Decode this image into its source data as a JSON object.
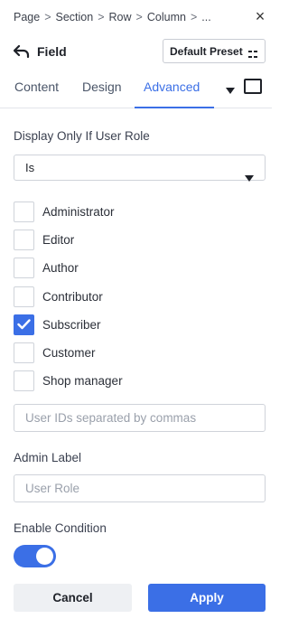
{
  "breadcrumb": {
    "items": [
      "Page",
      "Section",
      "Row",
      "Column",
      "..."
    ],
    "separator": ">"
  },
  "close_glyph": "×",
  "header": {
    "title": "Field",
    "preset_label": "Default Preset"
  },
  "tabs": [
    {
      "label": "Content",
      "active": false
    },
    {
      "label": "Design",
      "active": false
    },
    {
      "label": "Advanced",
      "active": true
    }
  ],
  "display_condition": {
    "label": "Display Only If User Role",
    "operator_value": "Is",
    "roles": [
      {
        "label": "Administrator",
        "checked": false
      },
      {
        "label": "Editor",
        "checked": false
      },
      {
        "label": "Author",
        "checked": false
      },
      {
        "label": "Contributor",
        "checked": false
      },
      {
        "label": "Subscriber",
        "checked": true
      },
      {
        "label": "Customer",
        "checked": false
      },
      {
        "label": "Shop manager",
        "checked": false
      }
    ],
    "user_ids_placeholder": "User IDs separated by commas"
  },
  "admin_label": {
    "label": "Admin Label",
    "placeholder": "User Role"
  },
  "enable_condition": {
    "label": "Enable Condition",
    "enabled": true
  },
  "actions": {
    "cancel_label": "Cancel",
    "apply_label": "Apply"
  },
  "colors": {
    "accent": "#3b6fe6",
    "border": "#cfd3da",
    "cancel_bg": "#eef0f3"
  },
  "icons": {
    "back": "back-arrow-icon",
    "close": "close-icon",
    "preset": "preset-grid-icon",
    "tabs_more": "caret-down-icon",
    "view": "responsive-square-icon",
    "select": "caret-down-icon",
    "check": "checkmark-icon"
  }
}
